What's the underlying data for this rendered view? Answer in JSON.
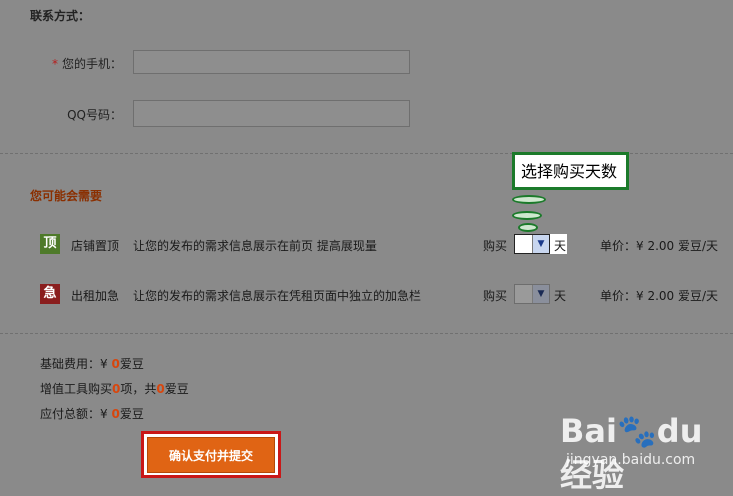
{
  "contact": {
    "title": "联系方式：",
    "phone_label": "您的手机：",
    "required_mark": "*",
    "qq_label": "QQ号码："
  },
  "needs": {
    "title": "您可能会需要",
    "items": [
      {
        "icon_char": "顶",
        "icon_color": "#4e7a2a",
        "name": "店铺置顶",
        "desc": "让您的发布的需求信息展示在前页 提高展现量",
        "buy_label": "购买",
        "unit": "天",
        "price_label": "单价：¥ 2.00 爱豆/天"
      },
      {
        "icon_char": "急",
        "icon_color": "#8a1e1e",
        "name": "出租加急",
        "desc": "让您的发布的需求信息展示在凭租页面中独立的加急栏",
        "buy_label": "购买",
        "unit": "天",
        "price_label": "单价：¥ 2.00 爱豆/天"
      }
    ]
  },
  "callout": {
    "text": "选择购买天数"
  },
  "summary": {
    "base_prefix": "基础费用：¥ ",
    "base_value": "0",
    "base_unit": "爱豆",
    "tools_prefix": "增值工具购买",
    "tools_count": "0",
    "tools_mid": "项，共",
    "tools_value": "0",
    "tools_unit": "爱豆",
    "total_prefix": "应付总额：¥ ",
    "total_value": "0",
    "total_unit": "爱豆"
  },
  "submit": {
    "label": "确认支付并提交"
  },
  "watermark": {
    "logo": "Bai🐾du经验",
    "url": "jingyan.baidu.com"
  }
}
